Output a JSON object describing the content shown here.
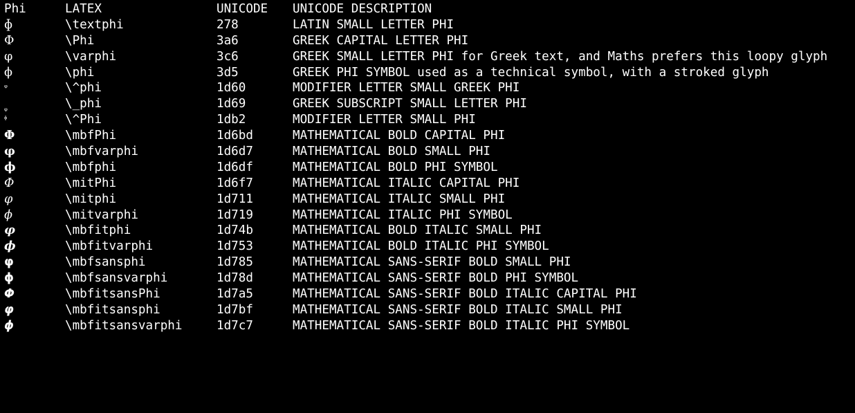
{
  "header": {
    "col_symbol": "Phi",
    "col_latex": "LATEX",
    "col_unicode": "UNICODE",
    "col_description": "UNICODE DESCRIPTION"
  },
  "rows": [
    {
      "glyph": "ɸ",
      "latex": "\\textphi",
      "code": "278",
      "description": "LATIN SMALL LETTER PHI"
    },
    {
      "glyph": "Φ",
      "latex": "\\Phi",
      "code": "3a6",
      "description": "GREEK CAPITAL LETTER PHI"
    },
    {
      "glyph": "φ",
      "latex": "\\varphi",
      "code": "3c6",
      "description": "GREEK SMALL LETTER PHI for Greek text, and Maths prefers this loopy glyph"
    },
    {
      "glyph": "ϕ",
      "latex": "\\phi",
      "code": "3d5",
      "description": "GREEK PHI SYMBOL used as a technical symbol, with a stroked glyph"
    },
    {
      "glyph": "ᵠ",
      "latex": "\\^phi",
      "code": "1d60",
      "description": "MODIFIER LETTER SMALL GREEK PHI"
    },
    {
      "glyph": "ᵩ",
      "latex": "\\_phi",
      "code": "1d69",
      "description": "GREEK SUBSCRIPT SMALL LETTER PHI"
    },
    {
      "glyph": "ᶲ",
      "latex": "\\^Phi",
      "code": "1db2",
      "description": "MODIFIER LETTER SMALL PHI"
    },
    {
      "glyph": "𝚽",
      "latex": "\\mbfPhi",
      "code": "1d6bd",
      "description": "MATHEMATICAL BOLD CAPITAL PHI"
    },
    {
      "glyph": "𝛗",
      "latex": "\\mbfvarphi",
      "code": "1d6d7",
      "description": "MATHEMATICAL BOLD SMALL PHI"
    },
    {
      "glyph": "𝛟",
      "latex": "\\mbfphi",
      "code": "1d6df",
      "description": "MATHEMATICAL BOLD PHI SYMBOL"
    },
    {
      "glyph": "𝛷",
      "latex": "\\mitPhi",
      "code": "1d6f7",
      "description": "MATHEMATICAL ITALIC CAPITAL PHI"
    },
    {
      "glyph": "𝜑",
      "latex": "\\mitphi",
      "code": "1d711",
      "description": "MATHEMATICAL ITALIC SMALL PHI"
    },
    {
      "glyph": "𝜙",
      "latex": "\\mitvarphi",
      "code": "1d719",
      "description": "MATHEMATICAL ITALIC PHI SYMBOL"
    },
    {
      "glyph": "𝝋",
      "latex": "\\mbfitphi",
      "code": "1d74b",
      "description": "MATHEMATICAL BOLD ITALIC SMALL PHI"
    },
    {
      "glyph": "𝝓",
      "latex": "\\mbfitvarphi",
      "code": "1d753",
      "description": "MATHEMATICAL BOLD ITALIC PHI SYMBOL"
    },
    {
      "glyph": "𝞅",
      "latex": "\\mbfsansphi",
      "code": "1d785",
      "description": "MATHEMATICAL SANS-SERIF BOLD SMALL PHI"
    },
    {
      "glyph": "𝞍",
      "latex": "\\mbfsansvarphi",
      "code": "1d78d",
      "description": "MATHEMATICAL SANS-SERIF BOLD PHI SYMBOL"
    },
    {
      "glyph": "𝞥",
      "latex": "\\mbfitsansPhi",
      "code": "1d7a5",
      "description": "MATHEMATICAL SANS-SERIF BOLD ITALIC CAPITAL PHI"
    },
    {
      "glyph": "𝞿",
      "latex": "\\mbfitsansphi",
      "code": "1d7bf",
      "description": "MATHEMATICAL SANS-SERIF BOLD ITALIC SMALL PHI"
    },
    {
      "glyph": "𝟇",
      "latex": "\\mbfitsansvarphi",
      "code": "1d7c7",
      "description": "MATHEMATICAL SANS-SERIF BOLD ITALIC PHI SYMBOL"
    }
  ],
  "colors": {
    "background": "#000000",
    "text": "#ffffff"
  }
}
